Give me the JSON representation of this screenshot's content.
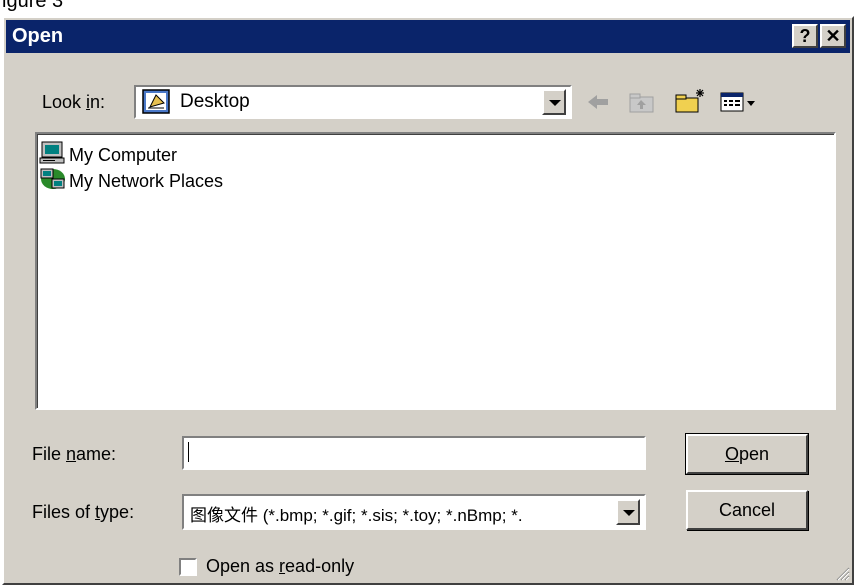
{
  "frame_caption": "igure 3",
  "dialog": {
    "title": "Open",
    "help_button": "?",
    "close_button": "✕"
  },
  "lookin": {
    "label_pre": "Look ",
    "label_ul": "i",
    "label_post": "n:",
    "value": "Desktop"
  },
  "toolbar": {
    "back_icon": "back-arrow-icon",
    "up_icon": "up-one-level-icon",
    "new_folder_icon": "create-new-folder-icon",
    "view_menu_icon": "view-menu-icon"
  },
  "list": {
    "items": [
      {
        "label": "My Computer",
        "icon": "my-computer-icon"
      },
      {
        "label": "My Network Places",
        "icon": "network-places-icon"
      }
    ]
  },
  "filename": {
    "label_pre": "File ",
    "label_ul": "n",
    "label_post": "ame:",
    "value": "",
    "placeholder": ""
  },
  "filetype": {
    "label_pre": "Files of ",
    "label_ul": "t",
    "label_post": "ype:",
    "value": "图像文件 (*.bmp; *.gif; *.sis; *.toy; *.nBmp; *."
  },
  "buttons": {
    "open_ul": "O",
    "open_rest": "pen",
    "cancel": "Cancel"
  },
  "readonly": {
    "label_pre": "Open as ",
    "label_ul": "r",
    "label_post": "ead-only",
    "checked": false
  },
  "colors": {
    "titlebar": "#0a246a",
    "face": "#d4d0c8"
  }
}
